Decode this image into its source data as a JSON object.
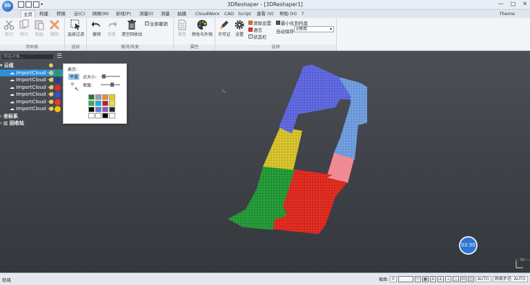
{
  "window": {
    "title": "3DReshaper - [3DReshaper1]",
    "logo": "3D",
    "controls": [
      "—",
      "□",
      "✕"
    ]
  },
  "menu": {
    "tabs": [
      "主页",
      "构建",
      "转换",
      "云(C)",
      "网格(M)",
      "折线(P)",
      "测量(I)",
      "测量",
      "拍摄",
      "CloudWorx",
      "CAD",
      "Script",
      "查看 (V)",
      "帮助 (H)"
    ],
    "help_glyph": "?",
    "theme": "Theme"
  },
  "ribbon": {
    "clipboard": {
      "label": "剪贴板",
      "cut": "剪切",
      "copy": "拷贝",
      "paste": "粘贴",
      "delete": "删除"
    },
    "select": {
      "label": "选择",
      "filter": "选择过滤"
    },
    "undo": {
      "label": "撤消/恢复",
      "undo": "撤销",
      "redo": "恢复",
      "clear": "清空回收站",
      "full_undo": "全部撤销"
    },
    "properties": {
      "label": "属性",
      "props": "属性",
      "color": "颜色与外观"
    },
    "options": {
      "label": "选项",
      "license": "许可证",
      "settings": "设置",
      "clear_settings": "清除设置",
      "language": "语言",
      "statusbar": "状态栏",
      "minimize": "最小化到托盘",
      "autosave": "自动保存",
      "autosave_value": "0停用"
    }
  },
  "panel": {
    "search_placeholder": "筛选对象...",
    "menu_glyph": "☰",
    "root": "云组",
    "items": [
      {
        "label": "ImportCloud - 1",
        "color": "#22a14b"
      },
      {
        "label": "ImportCloud - 2",
        "color": "#1f3f9e"
      },
      {
        "label": "ImportCloud - 3",
        "color": "#e02a2a"
      },
      {
        "label": "ImportCloud - 4",
        "color": "#3350d6"
      },
      {
        "label": "ImportCloud - 5",
        "color": "#e63b2e"
      },
      {
        "label": "ImportCloud - 6",
        "color": "#f2c200"
      }
    ],
    "coord": "坐标系",
    "recycle": "回收站"
  },
  "popup": {
    "title": "表示:",
    "mode_flat": "平滑",
    "mode_alt": "平",
    "point_size": "点大小:",
    "density": "密度:",
    "palette": [
      "#1e7d2e",
      "#9aa0a8",
      "#f08a2a",
      "#e8d400",
      "#27b84a",
      "#00b7e8",
      "#c51a1a",
      "#f7e21b",
      "#000000",
      "#5b7bd8",
      "#8f55c7",
      "#2a2a2a",
      "#ffffff",
      "#ffffff",
      "#000000",
      "#ffffff"
    ]
  },
  "status": {
    "ready": "就绪",
    "section": "截面:",
    "section_value": "0",
    "auto": "AUTO",
    "mesh": "网格步进: AUTO"
  },
  "viewport": {
    "timer": "02:30",
    "scale": "— 30 —",
    "axis_label": "x"
  }
}
